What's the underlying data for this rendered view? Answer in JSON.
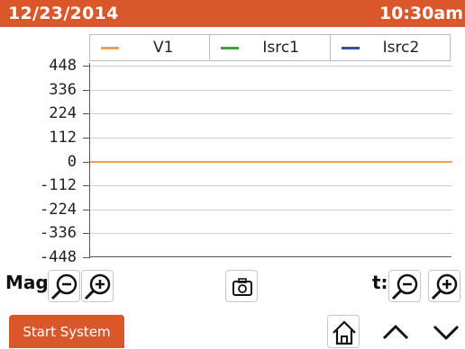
{
  "status_bar": {
    "date": "12/23/2014",
    "time": "10:30am"
  },
  "legend": [
    {
      "name": "V1",
      "color": "#f0a24a"
    },
    {
      "name": "Isrc1",
      "color": "#3aa43a"
    },
    {
      "name": "Isrc2",
      "color": "#3a4ea8"
    }
  ],
  "chart_data": {
    "type": "line",
    "y_ticks": [
      "448",
      "336",
      "224",
      "112",
      "0",
      "-112",
      "-224",
      "-336",
      "-448"
    ],
    "ylim": [
      -448,
      448
    ],
    "series": [
      {
        "name": "V1",
        "values": [
          0,
          0
        ]
      }
    ]
  },
  "controls": {
    "mag_label": "Mag:",
    "t_label": "t:",
    "start_label": "Start System"
  },
  "icons": {
    "zoom_out": "zoom-out-icon",
    "zoom_in": "zoom-in-icon",
    "snapshot": "camera-icon",
    "home": "home-icon",
    "up": "chevron-up-icon",
    "down": "chevron-down-icon"
  }
}
